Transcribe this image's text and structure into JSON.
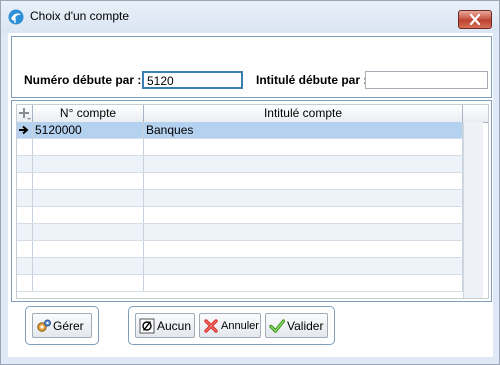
{
  "window": {
    "title": "Choix d'un compte"
  },
  "filters": {
    "numero_label": "Numéro débute par :",
    "numero_value": "5120",
    "intitule_label": "Intitulé débute par :",
    "intitule_value": ""
  },
  "grid": {
    "columns": [
      "N° compte",
      "Intitulé compte"
    ],
    "rows": [
      {
        "numero": "5120000",
        "intitule": "Banques",
        "selected": true
      }
    ]
  },
  "buttons": {
    "gerer": "Gérer",
    "aucun": "Aucun",
    "annuler": "Annuler",
    "valider": "Valider"
  }
}
